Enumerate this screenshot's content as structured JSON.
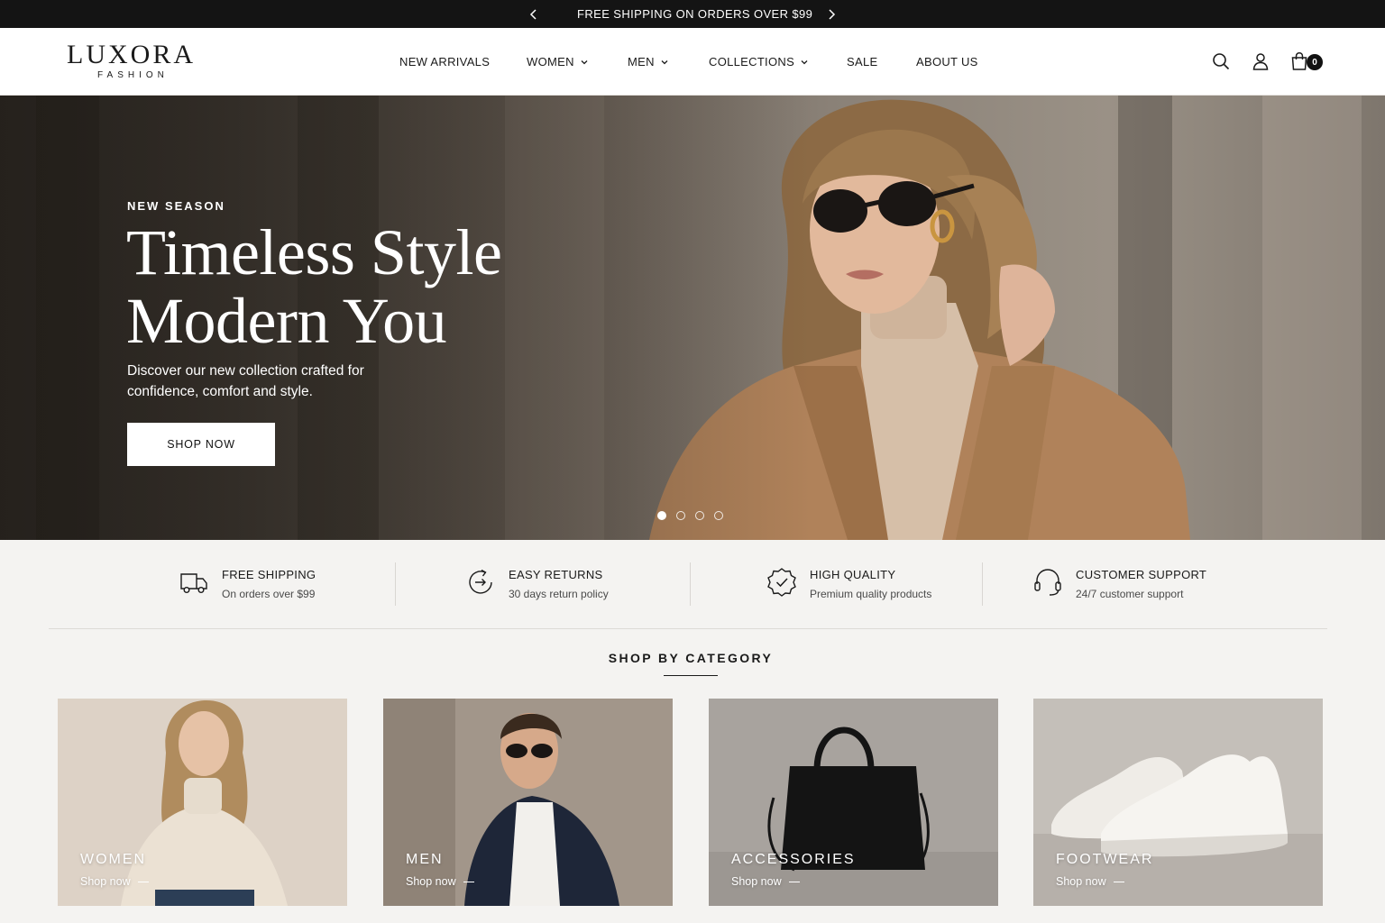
{
  "announcement": {
    "text": "FREE SHIPPING ON ORDERS OVER $99",
    "prev_icon": "chevron-left-icon",
    "next_icon": "chevron-right-icon"
  },
  "brand": {
    "name": "LUXORA",
    "tagline": "FASHION"
  },
  "nav": [
    {
      "label": "NEW ARRIVALS",
      "has_dropdown": false
    },
    {
      "label": "WOMEN",
      "has_dropdown": true
    },
    {
      "label": "MEN",
      "has_dropdown": true
    },
    {
      "label": "COLLECTIONS",
      "has_dropdown": true
    },
    {
      "label": "SALE",
      "has_dropdown": false
    },
    {
      "label": "ABOUT US",
      "has_dropdown": false
    }
  ],
  "header_icons": [
    "search-icon",
    "user-icon",
    "shopping-bag-icon"
  ],
  "cart": {
    "count": "0"
  },
  "hero": {
    "eyebrow": "NEW SEASON",
    "headline_line1": "Timeless Style",
    "headline_line2": "Modern You",
    "description": "Discover our new collection crafted for confidence, comfort and style.",
    "cta": "SHOP NOW",
    "slides_total": 4,
    "active_slide": 1
  },
  "features": [
    {
      "icon": "truck-icon",
      "title": "FREE SHIPPING",
      "subtitle": "On orders over $99"
    },
    {
      "icon": "return-arrow-icon",
      "title": "EASY RETURNS",
      "subtitle": "30 days return policy"
    },
    {
      "icon": "quality-badge-icon",
      "title": "HIGH QUALITY",
      "subtitle": "Premium quality products"
    },
    {
      "icon": "headset-icon",
      "title": "CUSTOMER SUPPORT",
      "subtitle": "24/7 customer support"
    }
  ],
  "categories_section": {
    "title": "SHOP BY CATEGORY",
    "items": [
      {
        "name": "WOMEN",
        "link": "Shop now"
      },
      {
        "name": "MEN",
        "link": "Shop now"
      },
      {
        "name": "ACCESSORIES",
        "link": "Shop now"
      },
      {
        "name": "FOOTWEAR",
        "link": "Shop now"
      }
    ]
  },
  "colors": {
    "announcement_bg": "#141414",
    "page_bg": "#f4f3f1",
    "header_bg": "#ffffff",
    "text": "#1a1a1a",
    "coat": "#b0825a"
  }
}
